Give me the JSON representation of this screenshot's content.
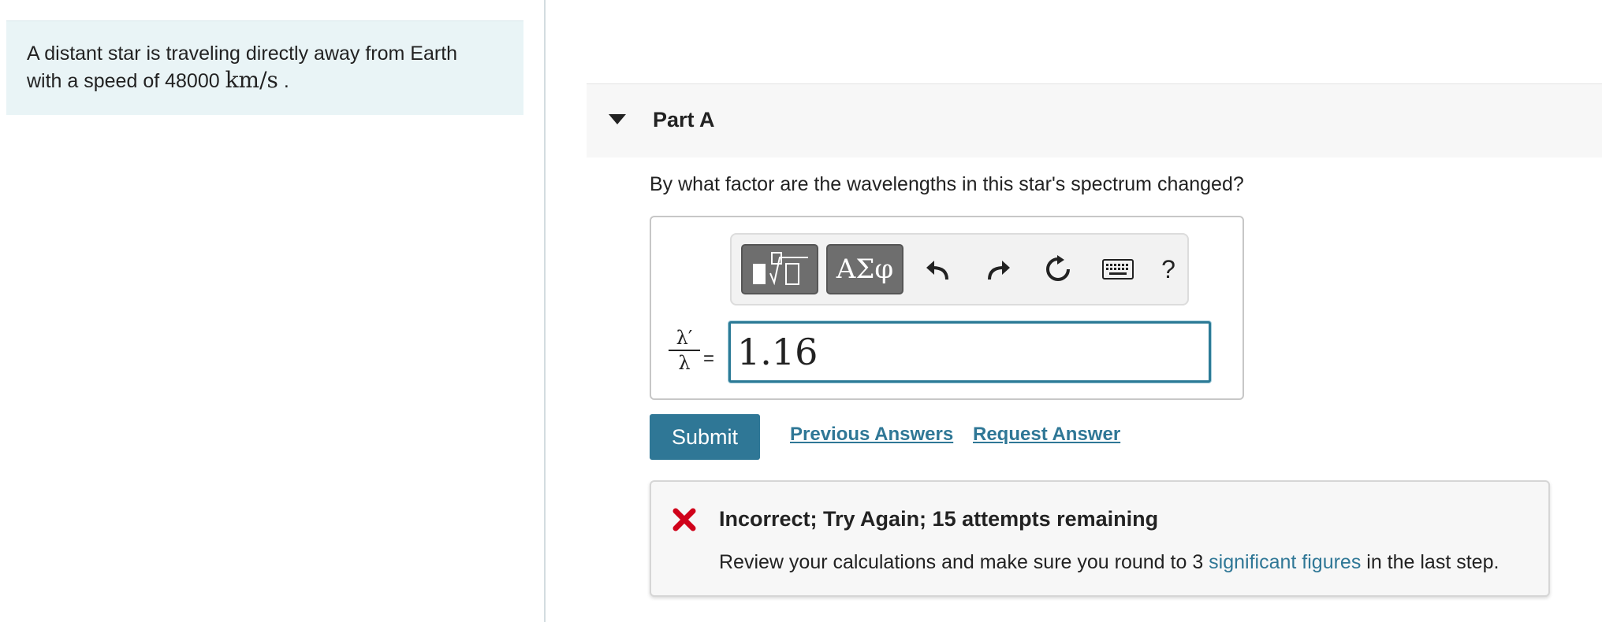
{
  "intro": {
    "text_line1": "A distant star is traveling directly away from Earth",
    "text_line2_prefix": "with a speed of 48000 ",
    "speed_unit": "km/s",
    "text_line2_suffix": " ."
  },
  "part": {
    "title": "Part A",
    "question": "By what factor are the wavelengths in this star's spectrum changed?"
  },
  "toolbar": {
    "greek_label": "ΑΣφ",
    "help_label": "?"
  },
  "equation": {
    "numerator": "λ′",
    "denominator": "λ",
    "equals": "=",
    "value": "1.16"
  },
  "actions": {
    "submit_label": "Submit",
    "previous_answers_label": "Previous Answers",
    "request_answer_label": "Request Answer"
  },
  "feedback": {
    "title": "Incorrect; Try Again; 15 attempts remaining",
    "body_prefix": "Review your calculations and make sure you round to 3 ",
    "body_link": "significant figures",
    "body_suffix": " in the last step."
  },
  "colors": {
    "accent": "#2f7796",
    "error": "#d0021b",
    "intro_bg": "#e9f4f6"
  }
}
